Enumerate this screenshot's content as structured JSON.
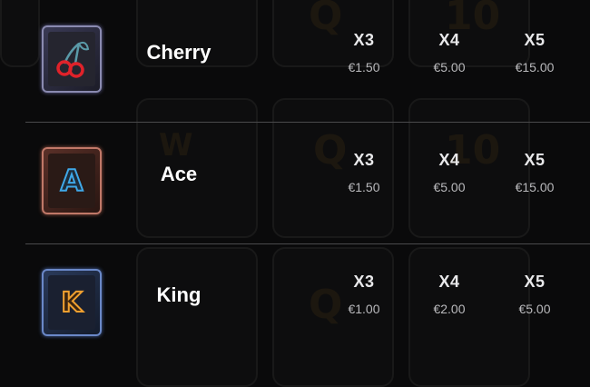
{
  "symbols": [
    {
      "name": "Cherry",
      "icon": "cherry-icon",
      "payouts": [
        {
          "mult": "X3",
          "amount": "€1.50"
        },
        {
          "mult": "X4",
          "amount": "€5.00"
        },
        {
          "mult": "X5",
          "amount": "€15.00"
        }
      ]
    },
    {
      "name": "Ace",
      "icon": "ace-icon",
      "letter": "A",
      "payouts": [
        {
          "mult": "X3",
          "amount": "€1.50"
        },
        {
          "mult": "X4",
          "amount": "€5.00"
        },
        {
          "mult": "X5",
          "amount": "€15.00"
        }
      ]
    },
    {
      "name": "King",
      "icon": "king-icon",
      "letter": "K",
      "payouts": [
        {
          "mult": "X3",
          "amount": "€1.00"
        },
        {
          "mult": "X4",
          "amount": "€2.00"
        },
        {
          "mult": "X5",
          "amount": "€5.00"
        }
      ]
    }
  ],
  "colors": {
    "background": "#0a0a0b",
    "divider": "#4a4a4c",
    "cherry_red": "#e0222a",
    "ace_blue": "#3fa8e8",
    "king_gold": "#f0a030"
  }
}
